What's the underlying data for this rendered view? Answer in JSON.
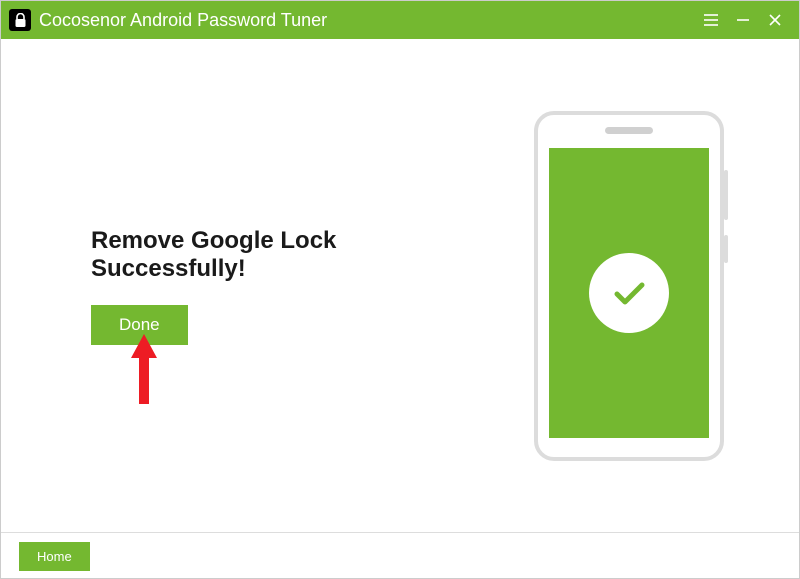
{
  "titlebar": {
    "app_title": "Cocosenor Android Password Tuner"
  },
  "main": {
    "headline": "Remove Google Lock Successfully!",
    "done_label": "Done"
  },
  "footer": {
    "home_label": "Home"
  },
  "colors": {
    "accent": "#74b830"
  },
  "icons": {
    "app": "lock-icon",
    "menu": "menu-icon",
    "minimize": "minimize-icon",
    "close": "close-icon",
    "success": "check-icon",
    "annotation": "arrow-up-icon"
  }
}
